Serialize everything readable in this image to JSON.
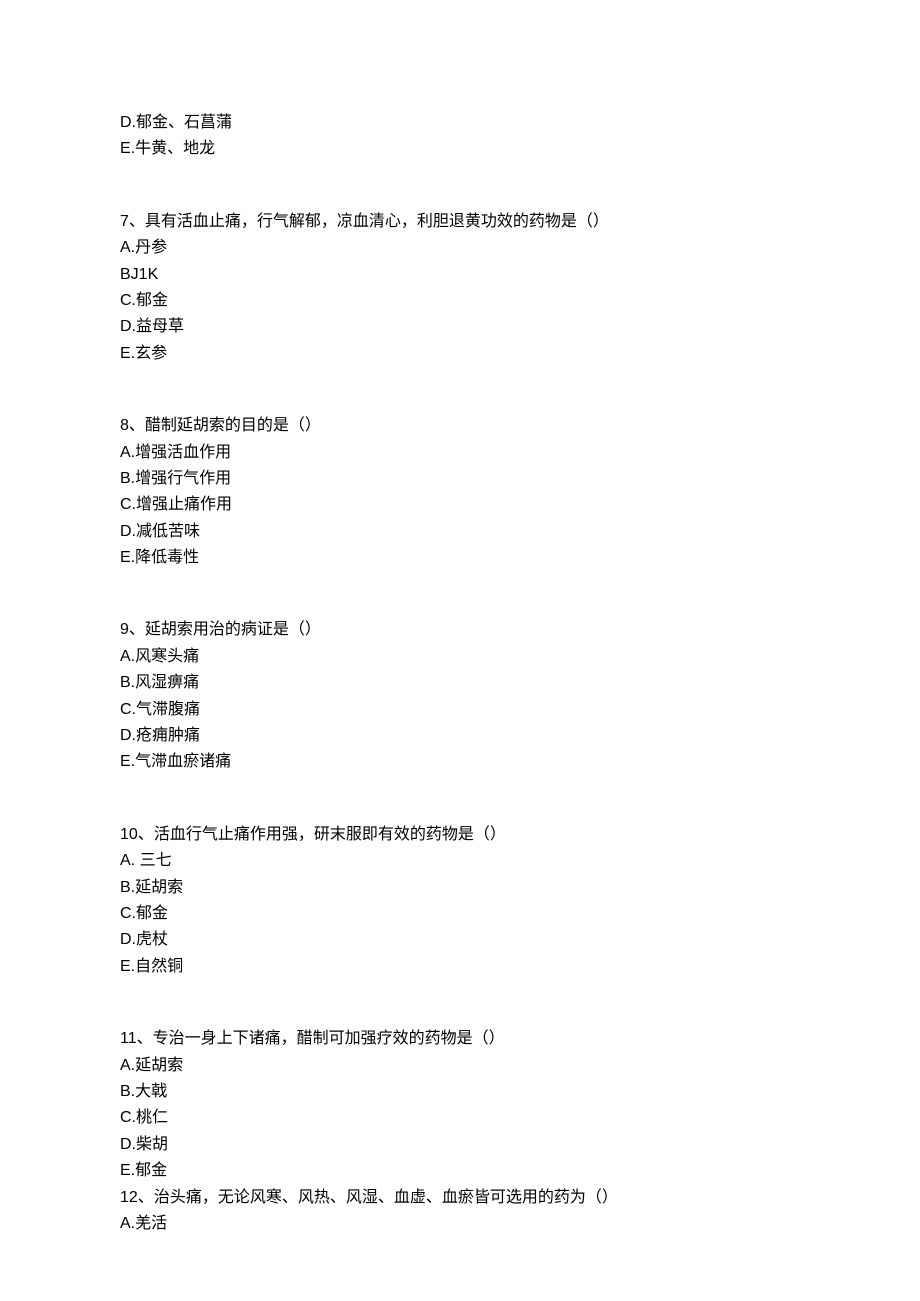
{
  "prev_options": {
    "d": {
      "letter": "D.",
      "text": "郁金、石菖蒲"
    },
    "e": {
      "letter": "E.",
      "text": "牛黄、地龙"
    }
  },
  "q7": {
    "num": "7、",
    "text": "具有活血止痛，行气解郁，凉血清心，利胆退黄功效的药物是（）",
    "a": {
      "letter": "A.",
      "text": "丹参"
    },
    "b": {
      "letter": "BJ1K",
      "text": ""
    },
    "c": {
      "letter": "C.",
      "text": "郁金"
    },
    "d": {
      "letter": "D.",
      "text": "益母草"
    },
    "e": {
      "letter": "E.",
      "text": "玄参"
    }
  },
  "q8": {
    "num": "8、",
    "text": "醋制延胡索的目的是（）",
    "a": {
      "letter": "A.",
      "text": "增强活血作用"
    },
    "b": {
      "letter": "B.",
      "text": "增强行气作用"
    },
    "c": {
      "letter": "C.",
      "text": "增强止痛作用"
    },
    "d": {
      "letter": "D.",
      "text": "减低苦味"
    },
    "e": {
      "letter": "E.",
      "text": "降低毒性"
    }
  },
  "q9": {
    "num": "9、",
    "text": "延胡索用治的病证是（）",
    "a": {
      "letter": "A.",
      "text": "风寒头痛"
    },
    "b": {
      "letter": "B.",
      "text": "风湿痹痛"
    },
    "c": {
      "letter": "C.",
      "text": "气滞腹痛"
    },
    "d": {
      "letter": "D.",
      "text": "疮痈肿痛"
    },
    "e": {
      "letter": "E.",
      "text": "气滞血瘀诸痛"
    }
  },
  "q10": {
    "num": "10、",
    "text": "活血行气止痛作用强，研末服即有效的药物是（）",
    "a": {
      "letter": "A. ",
      "text": "三七"
    },
    "b": {
      "letter": "B.",
      "text": "延胡索"
    },
    "c": {
      "letter": "C.",
      "text": "郁金"
    },
    "d": {
      "letter": "D.",
      "text": "虎杖"
    },
    "e": {
      "letter": "E.",
      "text": "自然铜"
    }
  },
  "q11": {
    "num": "11、",
    "text": "专治一身上下诸痛，醋制可加强疗效的药物是（）",
    "a": {
      "letter": "A.",
      "text": "延胡索"
    },
    "b": {
      "letter": "B.",
      "text": "大戟"
    },
    "c": {
      "letter": "C.",
      "text": "桃仁"
    },
    "d": {
      "letter": "D.",
      "text": "柴胡"
    },
    "e": {
      "letter": "E.",
      "text": "郁金"
    }
  },
  "q12": {
    "num": "12、",
    "text": "治头痛，无论风寒、风热、风湿、血虚、血瘀皆可选用的药为（）",
    "a": {
      "letter": "A.",
      "text": "羌活"
    }
  }
}
